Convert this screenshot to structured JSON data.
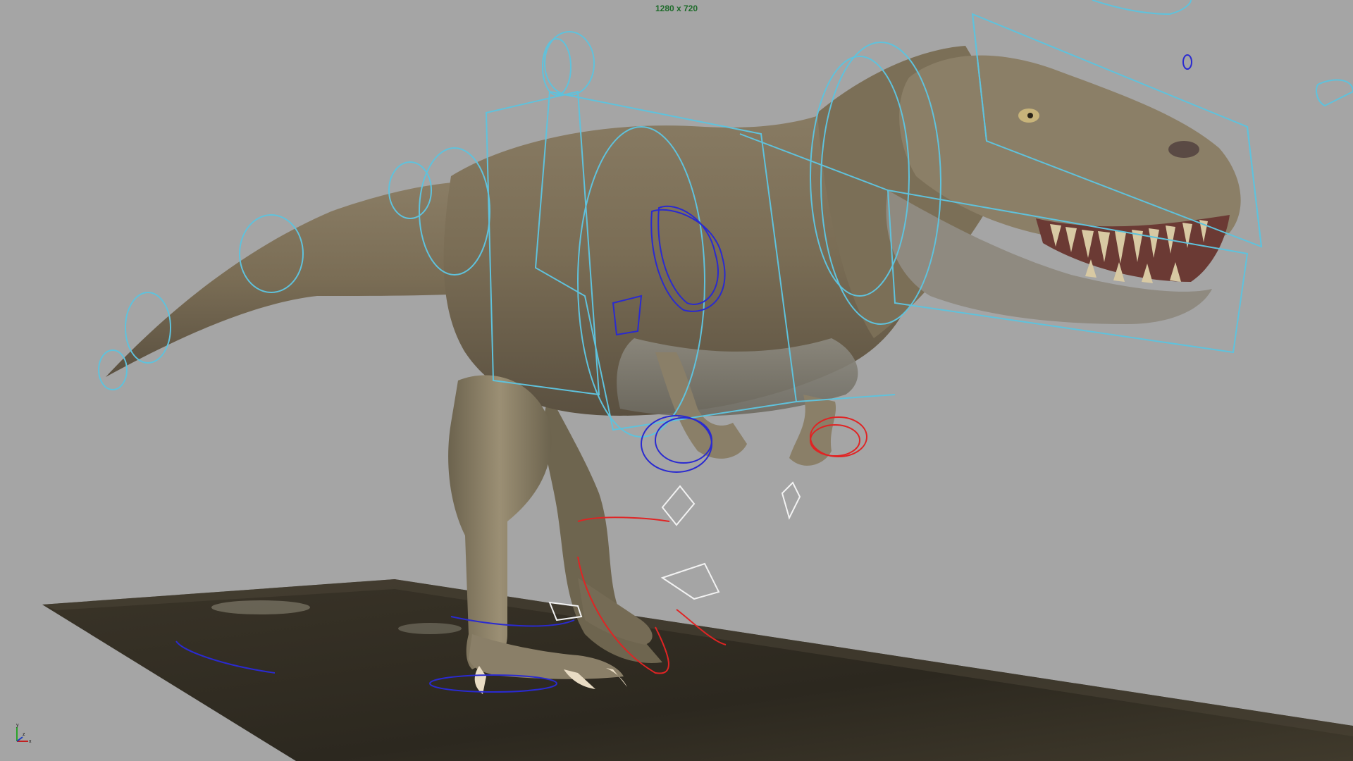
{
  "viewport": {
    "resolution_gate_label": "1280 x 720"
  },
  "axis_indicator": {
    "y_label": "y",
    "z_label": "z",
    "x_label": "x"
  }
}
